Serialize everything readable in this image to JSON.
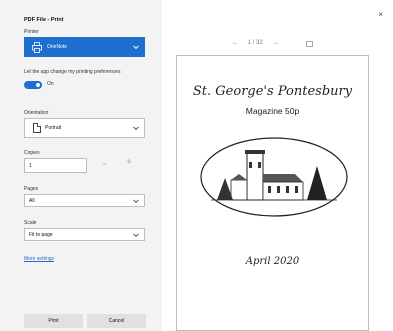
{
  "dialog": {
    "title": "PDF File - Print"
  },
  "printer": {
    "label": "Printer",
    "selected": "OneNote",
    "icon": "printer-icon"
  },
  "preferences": {
    "label": "Let the app change my printing preferences",
    "toggle_state": "On"
  },
  "orientation": {
    "label": "Orientation",
    "selected": "Portrait",
    "icon": "page-icon"
  },
  "copies": {
    "label": "Copies",
    "value": "1",
    "decrement": "−",
    "increment": "+"
  },
  "pages": {
    "label": "Pages",
    "selected": "All"
  },
  "scale": {
    "label": "Scale",
    "selected": "Fit to page"
  },
  "more_settings": "More settings",
  "buttons": {
    "print": "Print",
    "cancel": "Cancel"
  },
  "close": "×",
  "preview": {
    "prev": "←",
    "page_indicator": "1 / 32",
    "next": "→",
    "document": {
      "title": "St. George's Pontesbury",
      "subtitle": "Magazine 50p",
      "date": "April 2020"
    }
  },
  "colors": {
    "accent": "#1e6fcf",
    "panel": "#f3f3f3"
  }
}
